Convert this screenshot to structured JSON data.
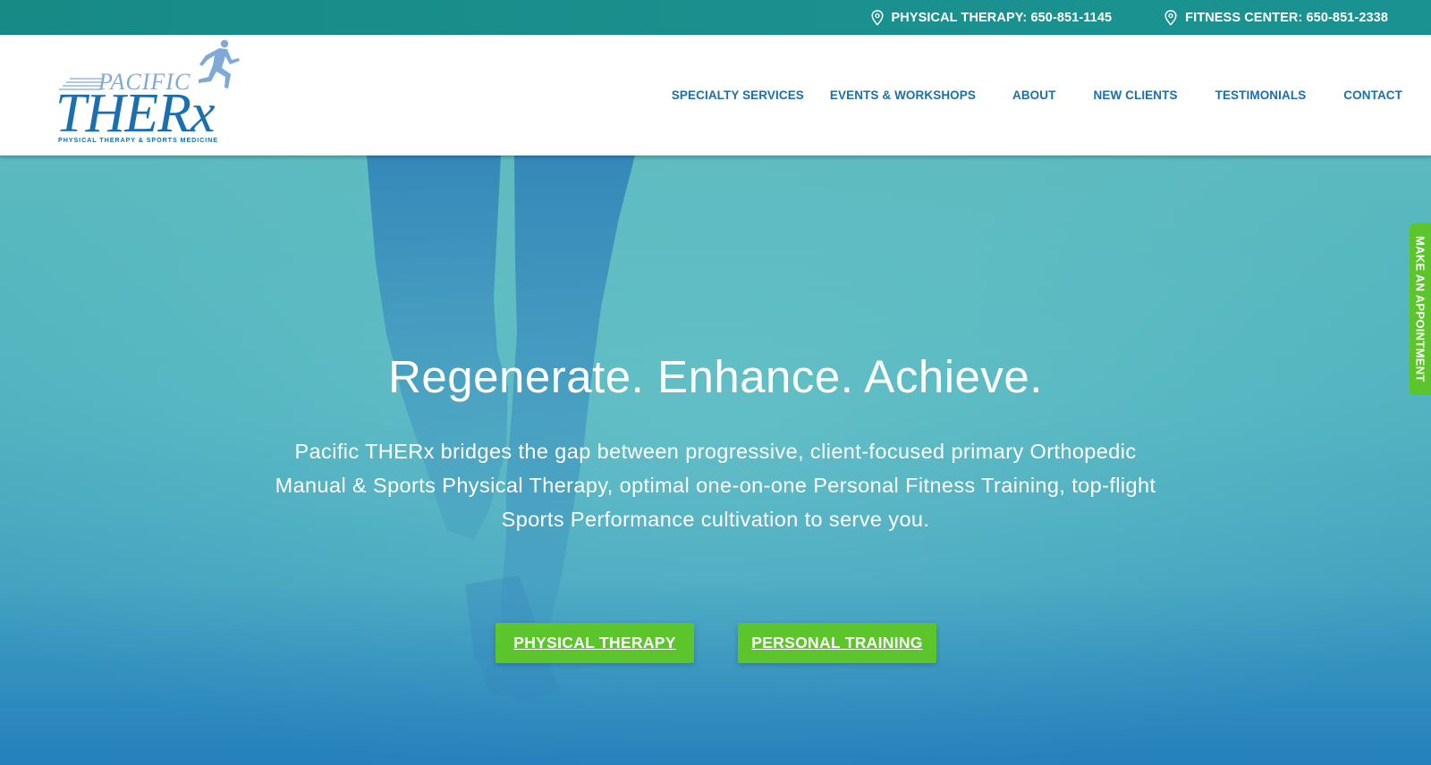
{
  "topbar": {
    "physical_therapy_phone": "PHYSICAL THERAPY: 650-851-1145",
    "fitness_center_phone": "FITNESS CENTER: 650-851-2338"
  },
  "logo": {
    "line1": "PACIFIC",
    "line2": "THERx",
    "tagline": "PHYSICAL THERAPY & SPORTS MEDICINE"
  },
  "nav": {
    "items": [
      {
        "label": "SPECIALTY SERVICES"
      },
      {
        "label": "EVENTS & WORKSHOPS"
      },
      {
        "label": "ABOUT"
      },
      {
        "label": "NEW CLIENTS"
      },
      {
        "label": "TESTIMONIALS"
      },
      {
        "label": "CONTACT"
      }
    ]
  },
  "hero": {
    "title": "Regenerate. Enhance. Achieve.",
    "description": "Pacific THERx bridges the gap between progressive, client-focused primary Orthopedic Manual & Sports Physical Therapy, optimal one-on-one Personal Fitness Training, top-flight Sports Performance cultivation to serve you.",
    "buttons": [
      {
        "label": "PHYSICAL THERAPY"
      },
      {
        "label": "PERSONAL TRAINING"
      }
    ]
  },
  "appointment_tab": {
    "label": "MAKE AN APPOINTMENT"
  },
  "colors": {
    "topbar": "#178a86",
    "nav_text": "#1d6fa8",
    "button_green": "#5cc52c",
    "hero_teal": "#4fb2bf",
    "logo_blue": "#1a6fb0",
    "logo_light_blue": "#7fa9d6"
  },
  "icons": {
    "location_pin": "map-pin-icon"
  }
}
